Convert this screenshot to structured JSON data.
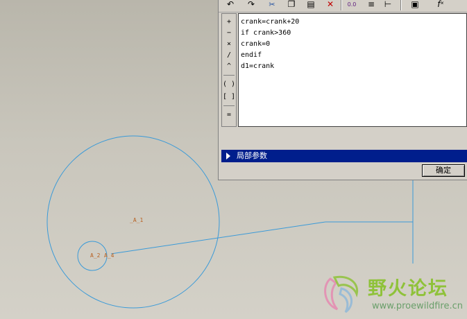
{
  "toolbar": {
    "icons": [
      "undo-icon",
      "redo-icon",
      "cut-icon",
      "copy-icon",
      "paste-icon",
      "delete-icon",
      "evaluate-icon",
      "unit-icon",
      "verify-icon",
      "sort-icon",
      "function-icon"
    ],
    "function_label": "fˣ"
  },
  "operators": [
    "+",
    "−",
    "×",
    "/",
    "^",
    "( )",
    "[ ]",
    "="
  ],
  "editor": {
    "lines": [
      "crank=crank+20",
      "if crank>360",
      "crank=0",
      "endif",
      "d1=crank"
    ]
  },
  "local_params": {
    "label": "局部参数"
  },
  "ok_button": {
    "label": "确定"
  },
  "sketch": {
    "label_a1": "_A_1",
    "label_a2": "A_2",
    "label_a4": "A_4",
    "line_color": "#3a9ad8"
  },
  "watermark": {
    "title": "野火论坛",
    "url": "www.proewildfire.cn"
  }
}
